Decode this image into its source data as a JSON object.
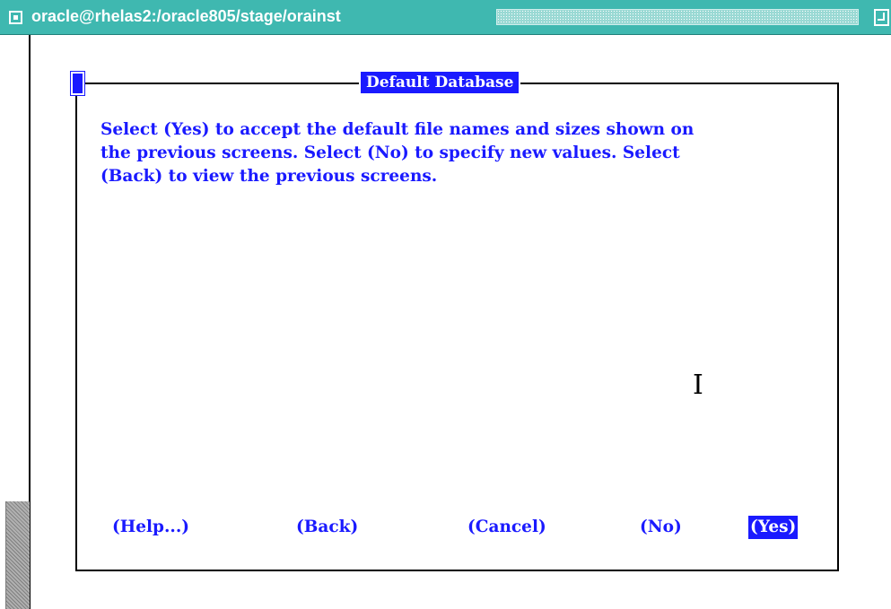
{
  "window": {
    "title": "oracle@rhelas2:/oracle805/stage/orainst"
  },
  "dialog": {
    "title": "Default Database",
    "message_lines": [
      "Select (Yes) to accept the default file names and sizes shown on",
      "the previous screens.  Select (No) to specify new values.  Select",
      "(Back) to view the previous screens."
    ],
    "buttons": {
      "help": "(Help...)",
      "back": "(Back)",
      "cancel": "(Cancel)",
      "no": "(No)",
      "yes": "(Yes)"
    },
    "selected_button": "yes"
  },
  "icons": {
    "window_menu": "window-menu-icon",
    "maximize": "maximize-icon",
    "text_cursor": "i-beam-cursor-icon"
  },
  "colors": {
    "titlebar": "#3fb8b0",
    "accent": "#1a1aff",
    "background": "#ffffff"
  }
}
